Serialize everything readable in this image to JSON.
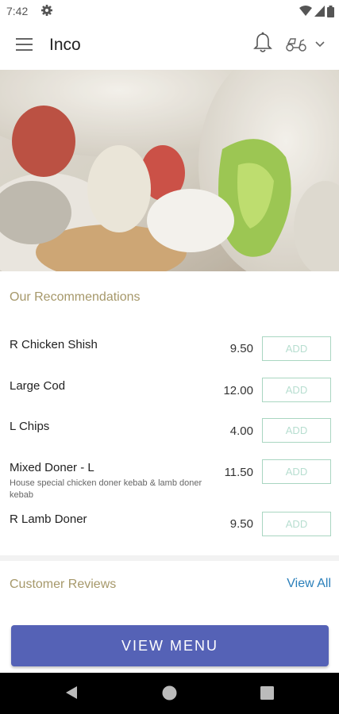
{
  "status_bar": {
    "time": "7:42"
  },
  "app_bar": {
    "title": "Inco"
  },
  "recommendations": {
    "title": "Our Recommendations",
    "items": [
      {
        "name": "R Chicken Shish",
        "description": "",
        "price": "9.50",
        "button": "ADD"
      },
      {
        "name": "Large Cod",
        "description": "",
        "price": "12.00",
        "button": "ADD"
      },
      {
        "name": "L Chips",
        "description": "",
        "price": "4.00",
        "button": "ADD"
      },
      {
        "name": "Mixed Doner - L",
        "description": "House special chicken doner kebab & lamb doner kebab",
        "price": "11.50",
        "button": "ADD"
      },
      {
        "name": "R Lamb Doner",
        "description": "",
        "price": "9.50",
        "button": "ADD"
      }
    ]
  },
  "reviews": {
    "title": "Customer Reviews",
    "view_all": "View All"
  },
  "cta": {
    "label": "VIEW MENU"
  },
  "colors": {
    "accent": "#5562b6",
    "section_title": "#a6986a",
    "link": "#2a7fba",
    "add_border": "#a9d6c1"
  }
}
